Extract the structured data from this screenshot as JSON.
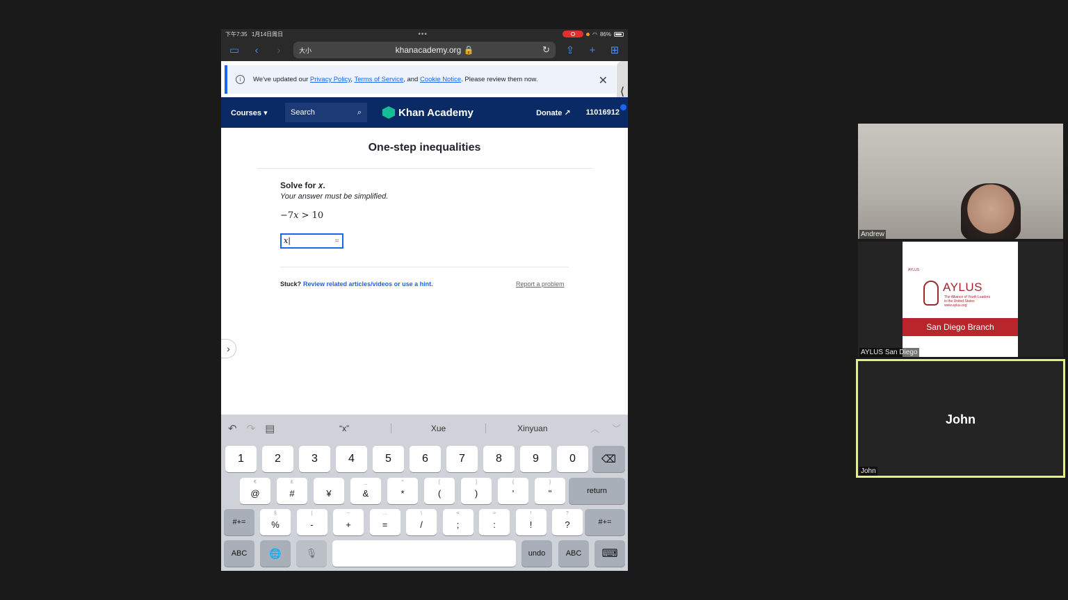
{
  "status": {
    "time": "下午7:35",
    "date": "1月14日周日",
    "battery": "86%"
  },
  "browser": {
    "text_size": "大小",
    "url": "khanacademy.org 🔒"
  },
  "notice": {
    "prefix": "We've updated our ",
    "privacy": "Privacy Policy",
    "sep1": ", ",
    "terms": "Terms of Service",
    "sep2": ", and ",
    "cookie": "Cookie Notice",
    "suffix": ". Please review them now."
  },
  "nav": {
    "courses": "Courses ▾",
    "search": "Search",
    "logo": "Khan Academy",
    "donate": "Donate ↗",
    "user": "11016912"
  },
  "exercise": {
    "title": "One-step inequalities",
    "instruction": "Solve for 𝑥.",
    "note": "Your answer must be simplified.",
    "equation": "−7𝑥 > 10",
    "answer_value": "x|",
    "stuck": "Stuck?",
    "hint_link": "Review related articles/videos or use a hint.",
    "report": "Report a problem"
  },
  "keyboard": {
    "suggestions": [
      "“x”",
      "Xue",
      "Xinyuan"
    ],
    "row1": [
      "1",
      "2",
      "3",
      "4",
      "5",
      "6",
      "7",
      "8",
      "9",
      "0"
    ],
    "row2": [
      {
        "sub": "€",
        "main": "@"
      },
      {
        "sub": "£",
        "main": "#"
      },
      {
        "sub": "",
        "main": "¥"
      },
      {
        "sub": "_",
        "main": "&"
      },
      {
        "sub": "^",
        "main": "*"
      },
      {
        "sub": "[",
        "main": "("
      },
      {
        "sub": "]",
        "main": ")"
      },
      {
        "sub": "{",
        "main": "'"
      },
      {
        "sub": "}",
        "main": "\""
      }
    ],
    "return": "return",
    "shift_label": "#+=",
    "row3": [
      {
        "sub": "§",
        "main": "%"
      },
      {
        "sub": "|",
        "main": "-"
      },
      {
        "sub": "~",
        "main": "+"
      },
      {
        "sub": "…",
        "main": "="
      },
      {
        "sub": "\\",
        "main": "/"
      },
      {
        "sub": "<",
        "main": ";"
      },
      {
        "sub": ">",
        "main": ":"
      },
      {
        "sub": "!",
        "main": "!"
      },
      {
        "sub": "?",
        "main": "?"
      }
    ],
    "abc": "ABC",
    "undo": "undo"
  },
  "participants": {
    "andrew": "Andrew",
    "aylus_tile": "AYLUS San Diego",
    "aylus_small": "AYLUS",
    "aylus_brand": "AYLUS",
    "aylus_tagline": "The Alliance of Youth Leaders in the United States",
    "aylus_web": "www.aylus.org",
    "aylus_branch": "San Diego Branch",
    "john": "John",
    "john_big": "John"
  }
}
